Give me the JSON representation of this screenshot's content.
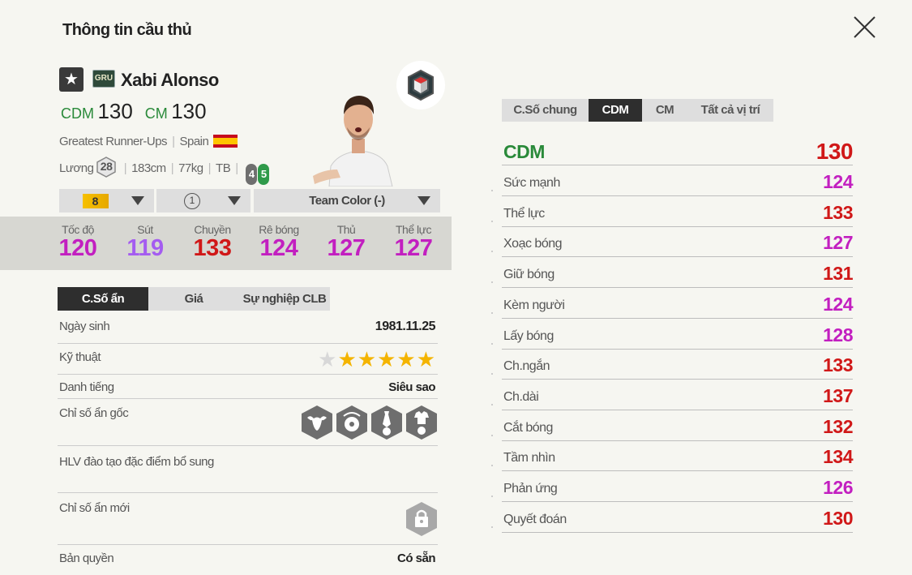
{
  "page_title": "Thông tin cầu thủ",
  "player": {
    "season_badge": "GRU",
    "name": "Xabi Alonso",
    "positions": [
      {
        "label": "CDM",
        "value": "130"
      },
      {
        "label": "CM",
        "value": "130"
      }
    ],
    "season_name": "Greatest Runner-Ups",
    "nation": "Spain",
    "salary_label": "Lương",
    "salary": "28",
    "height": "183cm",
    "weight": "77kg",
    "body_type": "TB",
    "weak_foot_left": "4",
    "weak_foot_right": "5"
  },
  "dropdowns": {
    "upgrade": "8",
    "training": "1",
    "team_color": "Team Color (-)"
  },
  "main_stats": [
    {
      "name": "Tốc độ",
      "value": "120",
      "color": "#c21fc0"
    },
    {
      "name": "Sút",
      "value": "119",
      "color": "#a45cf0"
    },
    {
      "name": "Chuyền",
      "value": "133",
      "color": "#d01818"
    },
    {
      "name": "Rê bóng",
      "value": "124",
      "color": "#c21fc0"
    },
    {
      "name": "Thủ",
      "value": "127",
      "color": "#c21fc0"
    },
    {
      "name": "Thể lực",
      "value": "127",
      "color": "#c21fc0"
    }
  ],
  "left_tabs": [
    "C.Số ẩn",
    "Giá",
    "Sự nghiệp CLB"
  ],
  "details": {
    "birth_label": "Ngày sinh",
    "birth_value": "1981.11.25",
    "skill_label": "Kỹ thuật",
    "skill_stars": 5,
    "reputation_label": "Danh tiếng",
    "reputation_value": "Siêu sao",
    "traits_label": "Chỉ số ẩn gốc",
    "traits": [
      "buffalo-trait-icon",
      "ball-swirl-trait-icon",
      "tie-ball-trait-icon",
      "shirt-ball-trait-icon"
    ],
    "coach_label": "HLV đào tạo đặc điểm bổ sung",
    "new_traits_label": "Chỉ số ẩn mới",
    "rights_label": "Bản quyền",
    "rights_value": "Có sẵn"
  },
  "right_tabs": [
    "C.Số chung",
    "CDM",
    "CM",
    "Tất cả vị trí"
  ],
  "position_header": {
    "label": "CDM",
    "value": "130",
    "label_color": "#2a8a3a",
    "value_color": "#d01818"
  },
  "attributes": [
    {
      "name": "Sức mạnh",
      "value": "124",
      "color": "#c21fc0"
    },
    {
      "name": "Thể lực",
      "value": "133",
      "color": "#d01818"
    },
    {
      "name": "Xoạc bóng",
      "value": "127",
      "color": "#c21fc0"
    },
    {
      "name": "Giữ bóng",
      "value": "131",
      "color": "#d01818"
    },
    {
      "name": "Kèm người",
      "value": "124",
      "color": "#c21fc0"
    },
    {
      "name": "Lấy bóng",
      "value": "128",
      "color": "#c21fc0"
    },
    {
      "name": "Ch.ngắn",
      "value": "133",
      "color": "#d01818"
    },
    {
      "name": "Ch.dài",
      "value": "137",
      "color": "#d01818"
    },
    {
      "name": "Cắt bóng",
      "value": "132",
      "color": "#d01818"
    },
    {
      "name": "Tầm nhìn",
      "value": "134",
      "color": "#d01818"
    },
    {
      "name": "Phản ứng",
      "value": "126",
      "color": "#c21fc0"
    },
    {
      "name": "Quyết đoán",
      "value": "130",
      "color": "#d01818"
    }
  ]
}
